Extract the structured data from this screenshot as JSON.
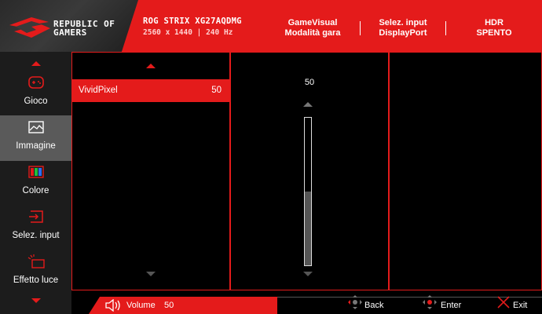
{
  "header": {
    "brand_line1": "REPUBLIC OF",
    "brand_line2": "GAMERS",
    "model_name": "ROG STRIX XG27AQDMG",
    "model_spec": "2560 x 1440  | 240 Hz",
    "gamevisual_label": "GameVisual",
    "gamevisual_value": "Modalità gara",
    "input_label": "Selez. input",
    "input_value": "DisplayPort",
    "hdr_label": "HDR",
    "hdr_value": "SPENTO"
  },
  "sidebar": {
    "items": [
      {
        "label": "Gioco",
        "icon": "gamepad-icon"
      },
      {
        "label": "Immagine",
        "icon": "image-icon"
      },
      {
        "label": "Colore",
        "icon": "color-icon"
      },
      {
        "label": "Selez. input",
        "icon": "input-icon"
      },
      {
        "label": "Effetto luce",
        "icon": "light-effect-icon"
      }
    ],
    "active": "Immagine"
  },
  "submenu": {
    "option_label": "VividPixel",
    "option_value": "50"
  },
  "slider": {
    "value": "50",
    "fill_fraction": 0.5
  },
  "footer": {
    "volume_label": "Volume",
    "volume_value": "50",
    "back_label": "Back",
    "enter_label": "Enter",
    "exit_label": "Exit"
  },
  "colors": {
    "accent": "#e41b1b",
    "sidebar_bg": "#1c1c1c",
    "active_bg": "#5a5a5a"
  }
}
